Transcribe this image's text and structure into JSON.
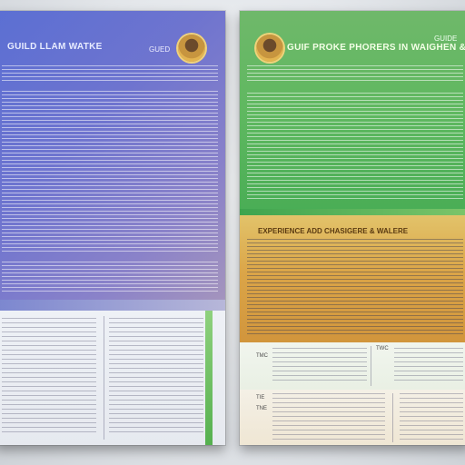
{
  "left_page": {
    "title": "GUILD LLAM WATKE",
    "corner_text": "GUED"
  },
  "right_page": {
    "title": "GUIF PROKE PHORERS IN WAIGHEN & WGDINE",
    "corner_text": "GUIDE",
    "section_heading": "EXPERIENCE ADD CHASIGERE & WALERE",
    "labels": [
      "TMC",
      "TWC",
      "TIE",
      "TNE"
    ]
  },
  "colors": {
    "left_top": "#5b6fd3",
    "left_bottom": "#eef1f6",
    "right_top": "#5fb860",
    "right_mid": "#dba548",
    "accent_green": "#55b04f",
    "portrait_gold": "#e3b450"
  },
  "icons": [
    "portrait-icon-left",
    "portrait-icon-right"
  ]
}
